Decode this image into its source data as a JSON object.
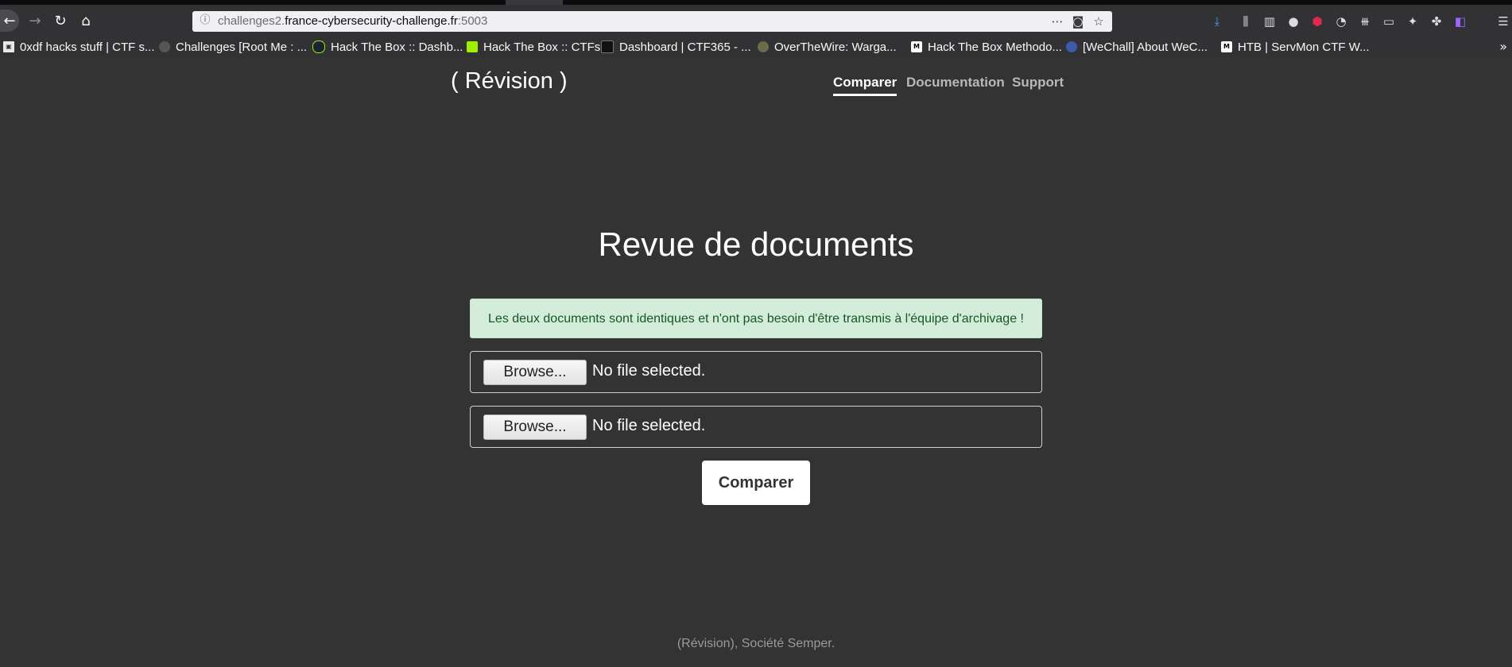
{
  "browser": {
    "url_prefix": "challenges2.",
    "url_domain": "france-cybersecurity-challenge.fr",
    "url_port": ":5003",
    "bookmarks": [
      {
        "label": "0xdf hacks stuff | CTF s...",
        "icon": "0xdf-favicon"
      },
      {
        "label": "Challenges [Root Me : ...",
        "icon": "rootme-favicon"
      },
      {
        "label": "Hack The Box :: Dashb...",
        "icon": "htb-favicon"
      },
      {
        "label": "Hack The Box :: CTFs",
        "icon": "htb-cube-favicon"
      },
      {
        "label": "Dashboard | CTF365 - ...",
        "icon": "ctf365-favicon"
      },
      {
        "label": "OverTheWire: Warga...",
        "icon": "overthewire-favicon"
      },
      {
        "label": "Hack The Box Methodo...",
        "icon": "medium-favicon"
      },
      {
        "label": "[WeChall] About WeC...",
        "icon": "wechall-favicon"
      },
      {
        "label": "HTB | ServMon CTF W...",
        "icon": "medium-favicon"
      }
    ]
  },
  "site": {
    "brand": "( Révision )",
    "nav": [
      {
        "label": "Comparer",
        "active": true
      },
      {
        "label": "Documentation",
        "active": false
      },
      {
        "label": "Support",
        "active": false
      }
    ]
  },
  "main": {
    "title": "Revue de documents",
    "alert": "Les deux documents sont identiques et n'ont pas besoin d'être transmis à l'équipe d'archivage !",
    "files": [
      {
        "button": "Browse...",
        "status": "No file selected."
      },
      {
        "button": "Browse...",
        "status": "No file selected."
      }
    ],
    "submit": "Comparer"
  },
  "footer": "(Révision), Société Semper.",
  "colors": {
    "background": "#333333",
    "alert_bg": "#d4edda",
    "alert_text": "#155724"
  }
}
